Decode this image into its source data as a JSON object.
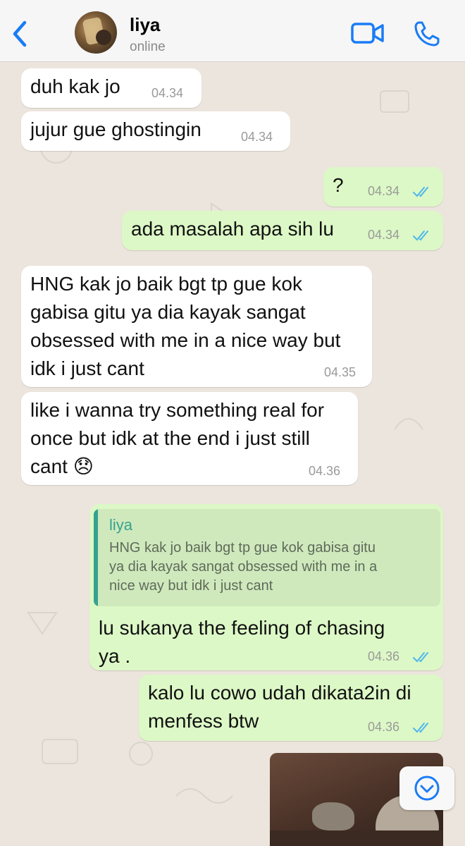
{
  "header": {
    "contact_name": "liya",
    "status": "online",
    "icons": {
      "back": "chevron-left-icon",
      "video": "video-camera-icon",
      "call": "phone-icon"
    },
    "accent_color": "#1a7cf5"
  },
  "messages": [
    {
      "dir": "in",
      "text": "duh kak jo",
      "time": "04.34"
    },
    {
      "dir": "in",
      "text": "jujur gue ghostingin",
      "time": "04.34"
    },
    {
      "dir": "out",
      "text": "?",
      "time": "04.34",
      "read": true
    },
    {
      "dir": "out",
      "text": "ada masalah apa sih lu",
      "time": "04.34",
      "read": true
    },
    {
      "dir": "in",
      "lines": [
        "HNG kak jo baik bgt tp gue kok",
        "gabisa gitu ya dia kayak sangat",
        "obsessed with me in a nice way but",
        "idk i just cant"
      ],
      "time": "04.35"
    },
    {
      "dir": "in",
      "lines": [
        "like i wanna try something real for",
        "once but idk at the end i just still",
        "cant 😞"
      ],
      "time": "04.36"
    },
    {
      "dir": "out",
      "reply_to": {
        "name": "liya",
        "lines": [
          "HNG kak jo baik bgt tp gue kok gabisa gitu",
          "ya dia kayak sangat obsessed with me in a",
          "nice way but idk i just cant"
        ]
      },
      "lines": [
        "lu sukanya the feeling of chasing",
        "ya ."
      ],
      "time": "04.36",
      "read": true
    },
    {
      "dir": "out",
      "lines": [
        "kalo lu cowo udah dikata2in di",
        "menfess btw"
      ],
      "time": "04.36",
      "read": true
    }
  ],
  "colors": {
    "incoming_bubble": "#ffffff",
    "outgoing_bubble": "#dcf8c6",
    "read_ticks": "#4fb6ec",
    "chat_background": "#ece5dd"
  },
  "scroll_button_icon": "chevron-down-circle-icon"
}
